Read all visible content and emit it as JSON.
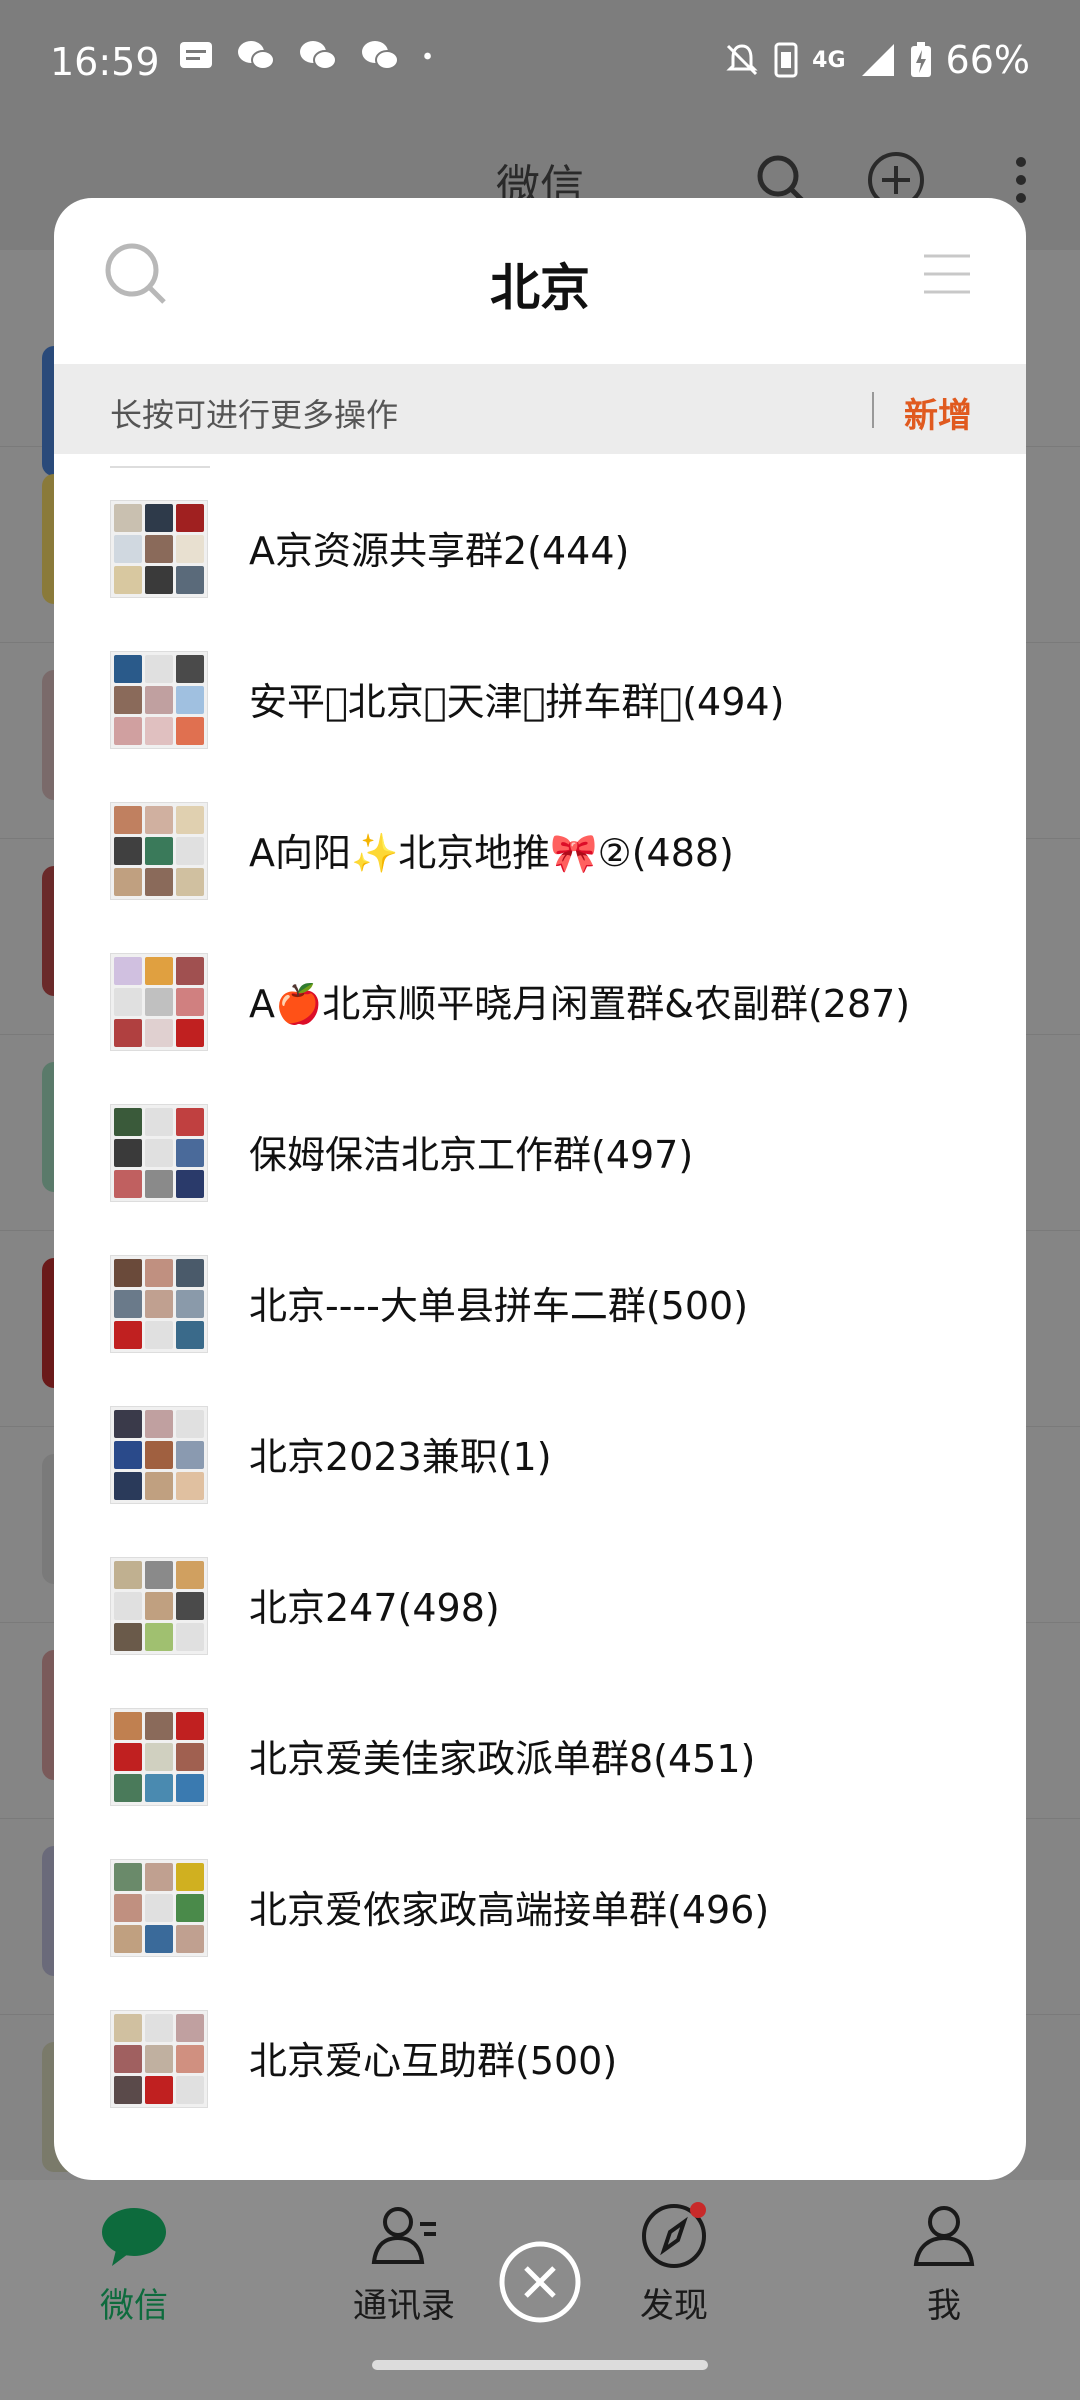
{
  "status_bar": {
    "time": "16:59",
    "battery": "66%",
    "network": "4G",
    "left_icons": [
      "message-icon",
      "wechat-icon",
      "wechat-icon",
      "wechat-icon",
      "dot-icon"
    ],
    "right_icons": [
      "mute-icon",
      "sim-icon",
      "signal-icon",
      "battery-icon"
    ]
  },
  "background_app": {
    "title": "微信",
    "icons": [
      "search-icon",
      "add-icon",
      "more-icon"
    ]
  },
  "modal": {
    "title": "北京",
    "hint": "长按可进行更多操作",
    "add_label": "新增",
    "groups": [
      {
        "name": "A京资源共享群2(444)",
        "colors": [
          "#c9c0b0",
          "#2e3a4a",
          "#a02020",
          "#d0d8e0",
          "#8a6a5a",
          "#e8e0d0",
          "#d8c8a0",
          "#3a3a3a",
          "#5a6a7a"
        ]
      },
      {
        "name": "安平\u0000北京\u0000天津\u0000拼车群\u0000(494)",
        "colors": [
          "#2a5a8a",
          "#e0e0e0",
          "#4a4a4a",
          "#8a6a5a",
          "#c0a0a0",
          "#a0c0e0",
          "#d0a0a0",
          "#e0c0c0",
          "#e07050"
        ]
      },
      {
        "name": "A向阳✨北京地推🎀②(488)",
        "colors": [
          "#c08060",
          "#d0b0a0",
          "#e0d0b0",
          "#404040",
          "#3a7a5a",
          "#e0e0e0",
          "#c0a080",
          "#8a6a5a",
          "#d0c0a0"
        ]
      },
      {
        "name": "A🍎北京顺平晓月闲置群&农副群(287)",
        "colors": [
          "#d0c0e0",
          "#e0a040",
          "#a05050",
          "#e0e0e0",
          "#c0c0c0",
          "#d08080",
          "#b04040",
          "#e0d0d0",
          "#c02020"
        ]
      },
      {
        "name": "保姆保洁北京工作群(497)",
        "colors": [
          "#3a5a3a",
          "#e0e0e0",
          "#c04040",
          "#3a3a3a",
          "#e0e0e0",
          "#4a6a9a",
          "#c06060",
          "#8a8a8a",
          "#2a3a6a"
        ]
      },
      {
        "name": "北京----大单县拼车二群(500)",
        "colors": [
          "#6a4a3a",
          "#c09080",
          "#4a5a6a",
          "#6a7a8a",
          "#c0a090",
          "#8a9aaa",
          "#c02020",
          "#e0e0e0",
          "#3a6a8a"
        ]
      },
      {
        "name": "北京2023兼职(1)",
        "colors": [
          "#3a3a4a",
          "#c0a0a0",
          "#e0e0e0",
          "#2a4a8a",
          "#a06040",
          "#8a9ab0",
          "#2a3a5a",
          "#c0a080",
          "#e0c0a0"
        ]
      },
      {
        "name": "北京247(498)",
        "colors": [
          "#c0b090",
          "#8a8a8a",
          "#d0a060",
          "#e0e0e0",
          "#c0a080",
          "#4a4a4a",
          "#6a5a4a",
          "#a0c070",
          "#e0e0e0"
        ]
      },
      {
        "name": "北京爱美佳家政派单群8(451)",
        "colors": [
          "#c08050",
          "#8a6a5a",
          "#c02020",
          "#c02020",
          "#d0d0c0",
          "#a06050",
          "#4a7a5a",
          "#4a8ab0",
          "#3a7ab0"
        ]
      },
      {
        "name": "北京爱侬家政高端接单群(496)",
        "colors": [
          "#6a8a6a",
          "#c0a090",
          "#d0b020",
          "#c09080",
          "#e0e0e0",
          "#4a8a4a",
          "#c0a080",
          "#3a6a9a",
          "#c0a090"
        ]
      },
      {
        "name": "北京爱心互助群(500)",
        "colors": [
          "#d0c0a0",
          "#e0e0e0",
          "#c0a0a0",
          "#a06060",
          "#c0b0a0",
          "#d09080",
          "#5a4a4a",
          "#c02020",
          "#e0e0e0"
        ]
      }
    ]
  },
  "bottom_nav": {
    "items": [
      {
        "label": "微信",
        "icon": "chat-icon"
      },
      {
        "label": "通讯录",
        "icon": "contacts-icon"
      },
      {
        "label": "发现",
        "icon": "compass-icon"
      },
      {
        "label": "我",
        "icon": "profile-icon"
      }
    ]
  },
  "colors": {
    "accent_orange": "#e05a1f",
    "wechat_green": "#0d6b3d"
  }
}
